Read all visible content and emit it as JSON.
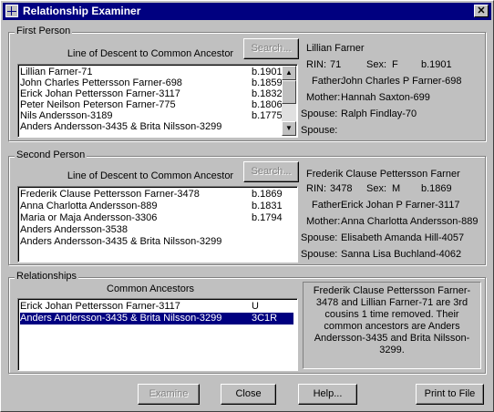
{
  "window": {
    "title": "Relationship Examiner",
    "close_glyph": "✕"
  },
  "first_person": {
    "group_title": "First Person",
    "line_caption": "Line of Descent to Common Ancestor",
    "search_label": "Search...",
    "list": [
      {
        "name": "Lillian Farner-71",
        "year": "b.1901"
      },
      {
        "name": "John Charles Pettersson Farner-698",
        "year": "b.1859"
      },
      {
        "name": "Erick Johan Pettersson Farner-3117",
        "year": "b.1832"
      },
      {
        "name": "Peter Neilson Peterson Farner-775",
        "year": "b.1806"
      },
      {
        "name": "Nils Andersson-3189",
        "year": "b.1775"
      },
      {
        "name": "Anders Andersson-3435 & Brita Nilsson-3299",
        "year": ""
      }
    ],
    "info": {
      "name": "Lillian Farner",
      "rin_label": "RIN:",
      "rin": "71",
      "sex_label": "Sex:",
      "sex": "F",
      "birth": "b.1901",
      "father_label": "Father:",
      "father": "John Charles P Farner-698",
      "mother_label": "Mother:",
      "mother": "Hannah Saxton-699",
      "spouse_label": "Spouse:",
      "spouse1": "Ralph Findlay-70",
      "spouse2": ""
    }
  },
  "second_person": {
    "group_title": "Second Person",
    "line_caption": "Line of Descent to Common Ancestor",
    "search_label": "Search...",
    "list": [
      {
        "name": "Frederik Clause Pettersson Farner-3478",
        "year": "b.1869"
      },
      {
        "name": "Anna Charlotta Andersson-889",
        "year": "b.1831"
      },
      {
        "name": "Maria or Maja Andersson-3306",
        "year": "b.1794"
      },
      {
        "name": "Anders Andersson-3538",
        "year": ""
      },
      {
        "name": "Anders Andersson-3435 & Brita Nilsson-3299",
        "year": ""
      }
    ],
    "info": {
      "name": "Frederik Clause Pettersson Farner",
      "rin_label": "RIN:",
      "rin": "3478",
      "sex_label": "Sex:",
      "sex": "M",
      "birth": "b.1869",
      "father_label": "Father:",
      "father": "Erick Johan P Farner-3117",
      "mother_label": "Mother:",
      "mother": "Anna Charlotta Andersson-889",
      "spouse_label": "Spouse:",
      "spouse1": "Elisabeth Amanda Hill-4057",
      "spouse2": "Sanna Lisa Buchland-4062"
    }
  },
  "relationships": {
    "group_title": "Relationships",
    "common_caption": "Common Ancestors",
    "list": [
      {
        "name": "Erick Johan Pettersson Farner-3117",
        "code": "U",
        "selected": false
      },
      {
        "name": "Anders Andersson-3435 & Brita Nilsson-3299",
        "code": "3C1R",
        "selected": true
      }
    ],
    "description": "Frederik Clause Pettersson Farner-3478 and Lillian Farner-71 are 3rd cousins 1 time removed.  Their common ancestors are Anders Andersson-3435 and Brita Nilsson-3299."
  },
  "buttons": {
    "examine": "Examine",
    "close": "Close",
    "help": "Help...",
    "print": "Print to File"
  },
  "colors": {
    "title_bar": "#000080",
    "selection": "#000080",
    "face": "#c0c0c0"
  },
  "icons": {
    "scroll_up": "scroll-up-arrow-icon",
    "scroll_down": "scroll-down-arrow-icon",
    "app": "app-icon",
    "close": "close-icon"
  }
}
